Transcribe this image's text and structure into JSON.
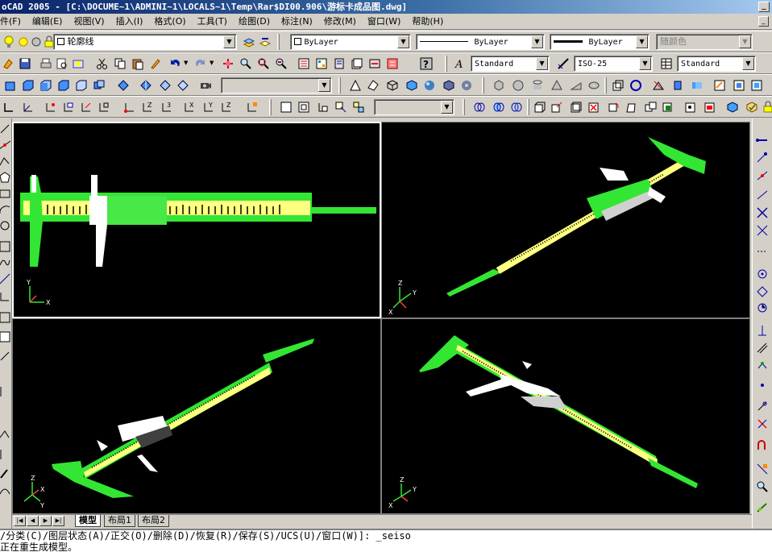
{
  "window": {
    "title": "oCAD 2005 - [C:\\DOCUME~1\\ADMINI~1\\LOCALS~1\\Temp\\Rar$DI00.906\\游标卡成品图.dwg]"
  },
  "menu": [
    {
      "label": "件(F)"
    },
    {
      "label": "编辑(E)"
    },
    {
      "label": "视图(V)"
    },
    {
      "label": "插入(I)"
    },
    {
      "label": "格式(O)"
    },
    {
      "label": "工具(T)"
    },
    {
      "label": "绘图(D)"
    },
    {
      "label": "标注(N)"
    },
    {
      "label": "修改(M)"
    },
    {
      "label": "窗口(W)"
    },
    {
      "label": "帮助(H)"
    }
  ],
  "toolbar": {
    "layer_name": "轮廓线",
    "color": "ByLayer",
    "linetype": "ByLayer",
    "lineweight": "ByLayer",
    "plotstyle": "随颜色",
    "text_style": "Standard",
    "dim_style": "ISO-25",
    "table_style": "Standard"
  },
  "layout_tabs": [
    {
      "label": "模型",
      "active": true
    },
    {
      "label": "布局1",
      "active": false
    },
    {
      "label": "布局2",
      "active": false
    }
  ],
  "command_line": {
    "line1": "/分类(C)/图层状态(A)/正交(O)/删除(D)/恢复(R)/保存(S)/UCS(U)/窗口(W)]: _seiso",
    "line2": "正在重生成模型。"
  },
  "viewports": [
    {
      "name": "front",
      "ucs_axes": [
        "Y",
        "X"
      ]
    },
    {
      "name": "se-iso",
      "ucs_axes": [
        "Z",
        "Y",
        "X"
      ]
    },
    {
      "name": "sw-iso",
      "ucs_axes": [
        "Z",
        "X",
        "Y"
      ]
    },
    {
      "name": "ne-iso",
      "ucs_axes": [
        "Z",
        "Y",
        "X"
      ]
    }
  ],
  "colors": {
    "canvas": "#000000",
    "caliper_body": "#33e633",
    "scale_band": "#ffff80",
    "slider": "#ffffff",
    "title_gradient_start": "#0a246a"
  }
}
